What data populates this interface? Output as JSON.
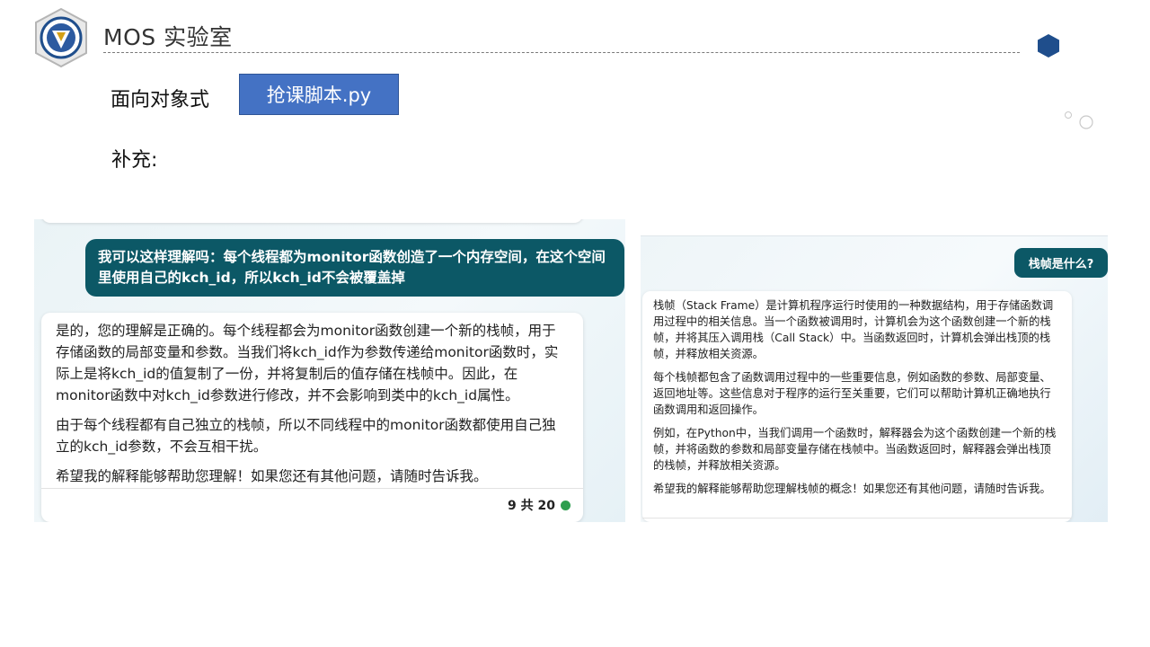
{
  "header": {
    "title": "MOS 实验室"
  },
  "slide": {
    "object_oriented_label": "面向对象式",
    "script_button_label": "抢课脚本.py",
    "supplement_label": "补充:"
  },
  "left_chat": {
    "user_message": "我可以这样理解吗：每个线程都为monitor函数创造了一个内存空间，在这个空间里使用自己的kch_id，所以kch_id不会被覆盖掉",
    "bot_paragraphs": [
      "是的，您的理解是正确的。每个线程都会为monitor函数创建一个新的栈帧，用于存储函数的局部变量和参数。当我们将kch_id作为参数传递给monitor函数时，实际上是将kch_id的值复制了一份，并将复制后的值存储在栈帧中。因此，在monitor函数中对kch_id参数进行修改，并不会影响到类中的kch_id属性。",
      "由于每个线程都有自己独立的栈帧，所以不同线程中的monitor函数都使用自己独立的kch_id参数，不会互相干扰。",
      "希望我的解释能够帮助您理解！如果您还有其他问题，请随时告诉我。"
    ],
    "turn_counter": "9 共 20"
  },
  "right_chat": {
    "user_message": "栈帧是什么?",
    "bot_paragraphs": [
      "栈帧（Stack Frame）是计算机程序运行时使用的一种数据结构，用于存储函数调用过程中的相关信息。当一个函数被调用时，计算机会为这个函数创建一个新的栈帧，并将其压入调用栈（Call Stack）中。当函数返回时，计算机会弹出栈顶的栈帧，并释放相关资源。",
      "每个栈帧都包含了函数调用过程中的一些重要信息，例如函数的参数、局部变量、返回地址等。这些信息对于程序的运行至关重要，它们可以帮助计算机正确地执行函数调用和返回操作。",
      "例如，在Python中，当我们调用一个函数时，解释器会为这个函数创建一个新的栈帧，并将函数的参数和局部变量存储在栈帧中。当函数返回时，解释器会弹出栈顶的栈帧，并释放相关资源。",
      "希望我的解释能够帮助您理解栈帧的概念！如果您还有其他问题，请随时告诉我。"
    ]
  },
  "colors": {
    "accent_blue": "#4472c4",
    "chat_user_bubble": "#0c5866",
    "hex_deco": "#1f4e8c",
    "status_green": "#2e9e4f"
  },
  "icons": {
    "logo": "shield-emblem-icon",
    "decoration": "hexagon-icon"
  }
}
